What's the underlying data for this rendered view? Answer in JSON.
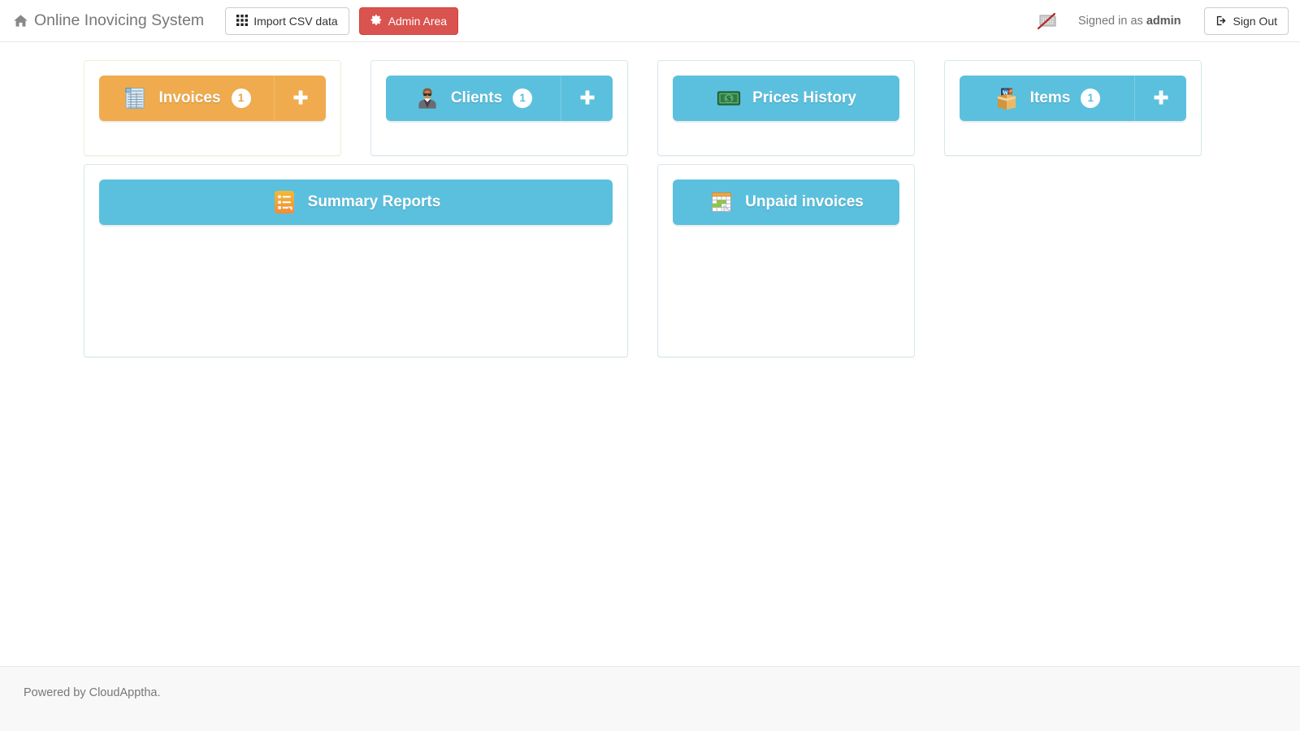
{
  "navbar": {
    "brand": {
      "label": "Online Inovicing System",
      "icon": "home-icon"
    },
    "buttons": [
      {
        "label": "Import CSV data",
        "icon": "grid-icon",
        "style": "default"
      },
      {
        "label": "Admin Area",
        "icon": "gear-icon",
        "style": "danger"
      }
    ],
    "language_icon": "keyboard-disabled-icon",
    "signed_in_prefix": "Signed in as",
    "signed_in_user": "admin",
    "sign_out": {
      "label": "Sign Out",
      "icon": "sign-out-icon"
    }
  },
  "tiles": {
    "row1": [
      {
        "key": "invoices",
        "label": "Invoices",
        "badge": "1",
        "has_add": true,
        "add_label": "+",
        "color": "orange",
        "accent": "#efab4d",
        "panel_border": "#f3ecd9",
        "icon": "invoice-list-icon"
      },
      {
        "key": "clients",
        "label": "Clients",
        "badge": "1",
        "has_add": true,
        "add_label": "+",
        "color": "blue",
        "accent": "#5bc0de",
        "panel_border": "#d8e7ec",
        "icon": "businessman-icon"
      },
      {
        "key": "prices-history",
        "label": "Prices History",
        "badge": null,
        "has_add": false,
        "add_label": "",
        "color": "blue",
        "accent": "#5bc0de",
        "panel_border": "#d8e7ec",
        "icon": "banknote-dollar-icon"
      },
      {
        "key": "items",
        "label": "Items",
        "badge": "1",
        "has_add": true,
        "add_label": "+",
        "color": "blue",
        "accent": "#5bc0de",
        "panel_border": "#d8e7ec",
        "icon": "package-box-icon"
      }
    ],
    "row2": [
      {
        "key": "summary-reports",
        "label": "Summary Reports",
        "badge": null,
        "has_add": false,
        "add_label": "",
        "color": "blue",
        "accent": "#5bc0de",
        "panel_border": "#d8e7ec",
        "icon": "report-list-icon"
      },
      {
        "key": "unpaid-invoices",
        "label": "Unpaid invoices",
        "badge": null,
        "has_add": false,
        "add_label": "",
        "color": "blue",
        "accent": "#5bc0de",
        "panel_border": "#d8e7ec",
        "icon": "calendar-spreadsheet-icon"
      }
    ]
  },
  "footer": {
    "text": "Powered by CloudApptha."
  }
}
